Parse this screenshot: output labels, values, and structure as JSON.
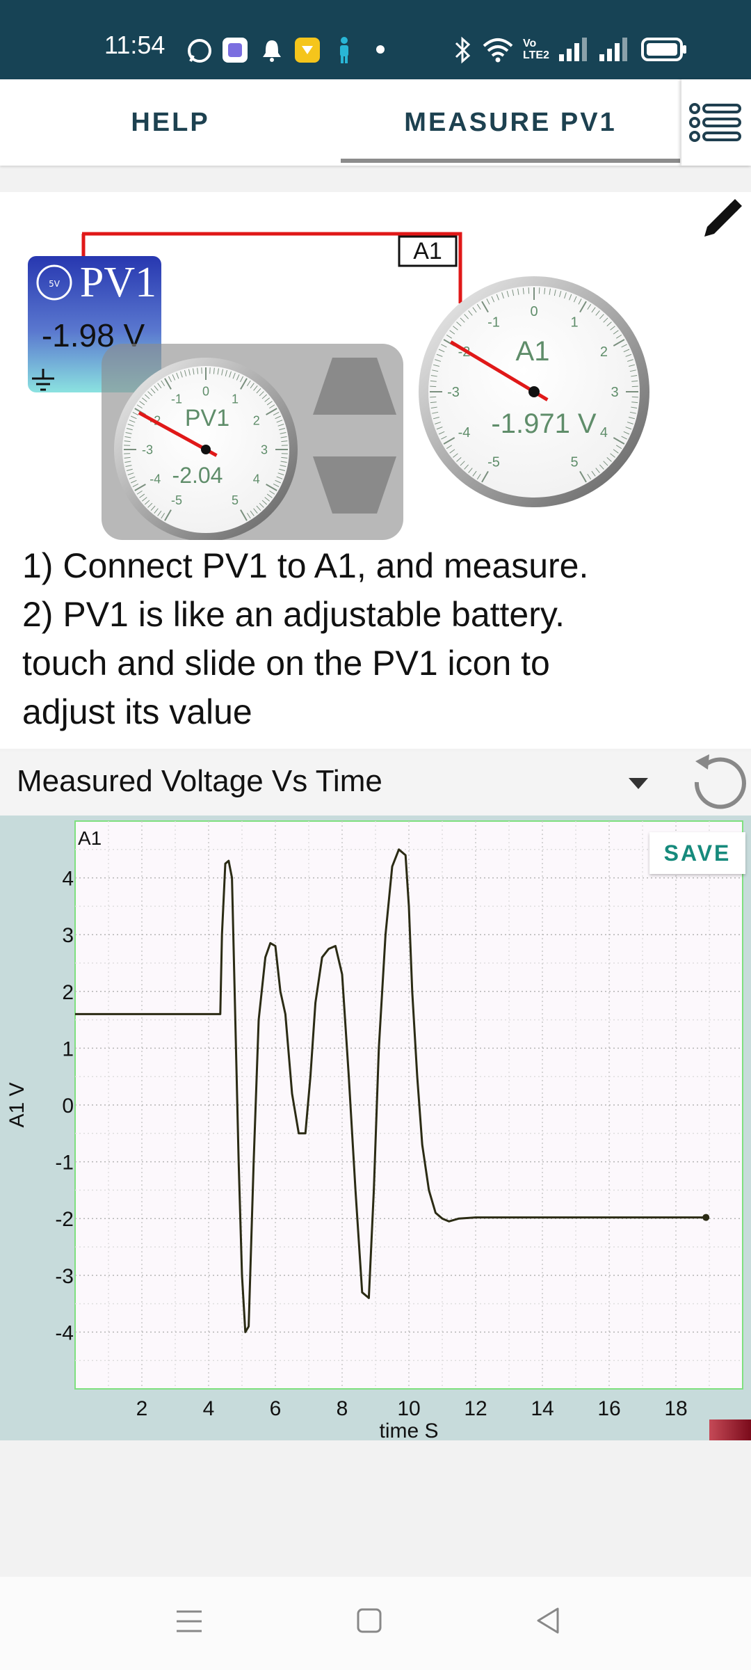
{
  "status_bar": {
    "time": "11:54",
    "volte_label": "Vo LTE2"
  },
  "tabs": {
    "help": "HELP",
    "measure": "MEASURE PV1"
  },
  "experiment": {
    "wire_label": "A1",
    "pv1_source": {
      "title": "PV1",
      "value": "-1.98 V",
      "badge": "5V"
    },
    "pv1_meter": {
      "label": "PV1",
      "value": "-2.04",
      "reading": -2.04
    },
    "a1_meter": {
      "label": "A1",
      "value": "-1.971 V",
      "reading": -1.971
    },
    "dial_ticks": [
      "-5",
      "-4",
      "-3",
      "-2",
      "-1",
      "0",
      "1",
      "2",
      "3",
      "4",
      "5"
    ],
    "instructions": [
      "1) Connect PV1 to A1, and measure.",
      "2) PV1 is like an adjustable battery.",
      "touch and slide on the PV1 icon to",
      "adjust its value"
    ]
  },
  "graph": {
    "selector_value": "Measured Voltage Vs Time",
    "save_label": "SAVE"
  },
  "chart_data": {
    "type": "line",
    "series": [
      {
        "name": "A1",
        "x": [
          0,
          4.35,
          4.4,
          4.5,
          4.6,
          4.7,
          4.8,
          4.9,
          5.0,
          5.1,
          5.2,
          5.35,
          5.5,
          5.7,
          5.85,
          6.0,
          6.15,
          6.3,
          6.5,
          6.7,
          6.9,
          7.05,
          7.2,
          7.4,
          7.6,
          7.8,
          8.0,
          8.2,
          8.4,
          8.6,
          8.8,
          8.95,
          9.1,
          9.3,
          9.5,
          9.7,
          9.9,
          10.0,
          10.1,
          10.25,
          10.4,
          10.6,
          10.8,
          11.0,
          11.2,
          11.5,
          12,
          14,
          16,
          18,
          18.9
        ],
        "y": [
          1.6,
          1.6,
          3.0,
          4.25,
          4.3,
          4.0,
          1.5,
          -1.0,
          -3.0,
          -4.0,
          -3.9,
          -1.0,
          1.5,
          2.6,
          2.85,
          2.8,
          2.0,
          1.6,
          0.2,
          -0.5,
          -0.5,
          0.5,
          1.8,
          2.6,
          2.75,
          2.8,
          2.3,
          0.5,
          -1.5,
          -3.3,
          -3.4,
          -1.5,
          1.0,
          3.0,
          4.2,
          4.5,
          4.4,
          3.5,
          2.0,
          0.5,
          -0.7,
          -1.5,
          -1.9,
          -2.0,
          -2.05,
          -2.0,
          -1.98,
          -1.98,
          -1.98,
          -1.98,
          -1.98
        ]
      }
    ],
    "series_label": "A1",
    "xlabel": "time S",
    "ylabel": "A1 V",
    "xlim": [
      0,
      20
    ],
    "ylim": [
      -5,
      5
    ],
    "x_ticks": [
      2,
      4,
      6,
      8,
      10,
      12,
      14,
      16,
      18
    ],
    "y_ticks": [
      -4,
      -3,
      -2,
      -1,
      0,
      1,
      2,
      3,
      4
    ],
    "grid": true,
    "line_color": "#2b2b14"
  }
}
